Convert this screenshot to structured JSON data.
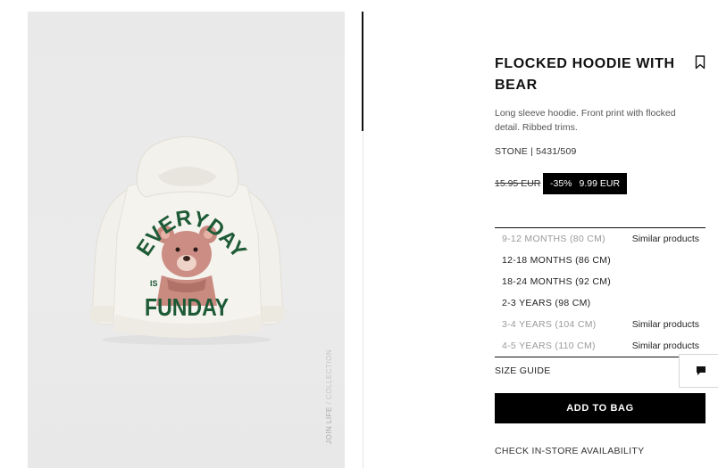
{
  "product": {
    "title": "FLOCKED HOODIE WITH BEAR",
    "description": "Long sleeve hoodie. Front print with flocked detail. Ribbed trims.",
    "reference": "STONE | 5431/509",
    "price_old": "15.95 EUR",
    "discount": "-35%",
    "price_new": "9.99 EUR",
    "print_text_top": "EVERYDAY",
    "print_text_small": "IS",
    "print_text_bottom": "FUNDAY",
    "image_watermark": "JOIN LIFE",
    "image_watermark_sep": "/",
    "image_watermark_suffix": "COLLECTION"
  },
  "sizes": [
    {
      "label": "9-12 MONTHS (80 CM)",
      "available": false,
      "note": "Similar products"
    },
    {
      "label": "12-18 MONTHS (86 CM)",
      "available": true,
      "note": ""
    },
    {
      "label": "18-24 MONTHS (92 CM)",
      "available": true,
      "note": ""
    },
    {
      "label": "2-3 YEARS (98 CM)",
      "available": true,
      "note": ""
    },
    {
      "label": "3-4 YEARS (104 CM)",
      "available": false,
      "note": "Similar products"
    },
    {
      "label": "4-5 YEARS (110 CM)",
      "available": false,
      "note": "Similar products"
    }
  ],
  "actions": {
    "size_guide": "SIZE GUIDE",
    "add_to_bag": "ADD TO BAG",
    "check_store": "CHECK IN-STORE AVAILABILITY"
  },
  "icons": {
    "bookmark": "bookmark-icon",
    "chat": "chat-icon"
  },
  "colors": {
    "print_green": "#1d5a36",
    "hoodie": "#f4f2ec",
    "bear": "#c98a80"
  }
}
